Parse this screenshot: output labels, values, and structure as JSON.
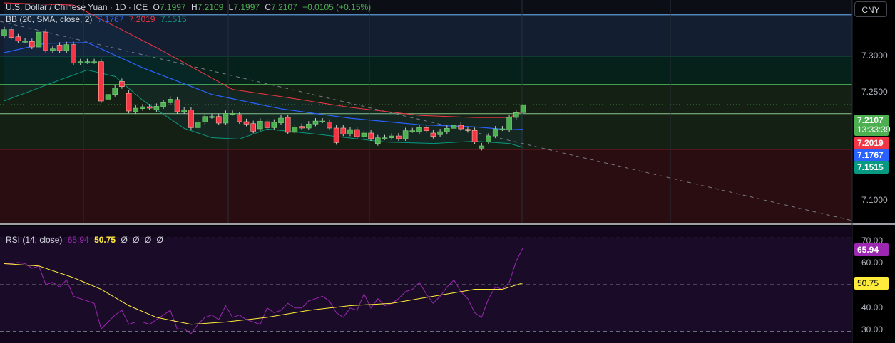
{
  "header": {
    "symbol": "U.S. Dollar / Chinese Yuan · 1D · ICE",
    "open_label": "O",
    "open": "7.1997",
    "high_label": "H",
    "high": "7.2109",
    "low_label": "L",
    "low": "7.1997",
    "close_label": "C",
    "close": "7.2107",
    "change": "+0.0105 (+0.15%)"
  },
  "bb": {
    "label": "BB (20, SMA, close, 2)",
    "basis": "7.1767",
    "upper": "7.2019",
    "lower": "7.1515"
  },
  "rsi": {
    "label": "RSI (14, close)",
    "value": "65.94",
    "ma": "50.75",
    "extra": [
      "Ø",
      "Ø",
      "Ø",
      "Ø"
    ]
  },
  "currency_button": "CNY",
  "price_axis": [
    "7.3000",
    "7.2500",
    "7.1000"
  ],
  "price_tags": {
    "last": "7.2107",
    "countdown": "13:33:39",
    "upper": "7.2019",
    "basis": "7.1767",
    "lower": "7.1515"
  },
  "rsi_axis": [
    "70.00",
    "60.00",
    "40.00",
    "30.00"
  ],
  "rsi_tags": {
    "rsi": "65.94",
    "ma": "50.75"
  },
  "colors": {
    "up": "#4caf50",
    "down": "#f23645",
    "basis": "#2962ff",
    "upper": "#f23645",
    "lower": "#089981",
    "rsi": "#9c27b0",
    "rsi_ma": "#ffeb3b"
  },
  "chart_data": {
    "type": "candlestick",
    "price_range": [
      7.047,
      7.356
    ],
    "zones": [
      {
        "from": 7.3355,
        "to": 7.2783,
        "fill": "#131e30",
        "line": "#5b9bd5"
      },
      {
        "from": 7.2783,
        "to": 7.2388,
        "fill": "#06201a",
        "line": "#2e8b7a"
      },
      {
        "from": 7.2388,
        "to": 7.149,
        "fill": "#142014",
        "line": "#4caf50"
      },
      {
        "from": 7.149,
        "to": 7.047,
        "fill": "#2a0d10",
        "line": "#c2353f"
      }
    ],
    "extra_level": 7.1983,
    "candles": [
      [
        7.3066,
        7.3148
      ],
      [
        7.3148,
        7.304
      ],
      [
        7.3049,
        7.299
      ],
      [
        7.299,
        7.299
      ],
      [
        7.2984,
        7.2908
      ],
      [
        7.2908,
        7.3115
      ],
      [
        7.3115,
        7.2859
      ],
      [
        7.2859,
        7.2882
      ],
      [
        7.2934,
        7.2859
      ],
      [
        7.2859,
        7.2941
      ],
      [
        7.2941,
        7.2684
      ],
      [
        7.2684,
        7.2704
      ],
      [
        7.2704,
        7.2704
      ],
      [
        7.2704,
        7.2704
      ],
      [
        7.2704,
        7.2158
      ],
      [
        7.2184,
        7.225
      ],
      [
        7.225,
        7.2339
      ],
      [
        7.2431,
        7.2359
      ],
      [
        7.2266,
        7.202
      ],
      [
        7.201,
        7.2059
      ],
      [
        7.2053,
        7.2079
      ],
      [
        7.2079,
        7.2059
      ],
      [
        7.2036,
        7.2085
      ],
      [
        7.2079,
        7.2135
      ],
      [
        7.2135,
        7.2184
      ],
      [
        7.2178,
        7.201
      ],
      [
        7.201,
        7.2036
      ],
      [
        7.2036,
        7.1789
      ],
      [
        7.1789,
        7.1865
      ],
      [
        7.1865,
        7.1944
      ],
      [
        7.1944,
        7.1944
      ],
      [
        7.1944,
        7.1852
      ],
      [
        7.1852,
        7.1987
      ],
      [
        7.1987,
        7.1987
      ],
      [
        7.197,
        7.1872
      ],
      [
        7.1872,
        7.1839
      ],
      [
        7.1845,
        7.174
      ],
      [
        7.1773,
        7.1878
      ],
      [
        7.1872,
        7.1789
      ],
      [
        7.1789,
        7.1865
      ],
      [
        7.1855,
        7.1921
      ],
      [
        7.1931,
        7.1724
      ],
      [
        7.1724,
        7.1799
      ],
      [
        7.1806,
        7.1783
      ],
      [
        7.1783,
        7.1839
      ],
      [
        7.1839,
        7.1881
      ],
      [
        7.1881,
        7.1881
      ],
      [
        7.1865,
        7.1783
      ],
      [
        7.1783,
        7.1582
      ],
      [
        7.1783,
        7.1701
      ],
      [
        7.1701,
        7.1763
      ],
      [
        7.1763,
        7.1664
      ],
      [
        7.1664,
        7.1714
      ],
      [
        7.1714,
        7.1635
      ],
      [
        7.1569,
        7.1648
      ],
      [
        7.1648,
        7.1648
      ],
      [
        7.1648,
        7.1674
      ],
      [
        7.1674,
        7.1635
      ],
      [
        7.1635,
        7.1747
      ],
      [
        7.1747,
        7.1747
      ],
      [
        7.1733,
        7.1789
      ],
      [
        7.1789,
        7.1747
      ],
      [
        7.1714,
        7.1668
      ],
      [
        7.1691,
        7.1733
      ],
      [
        7.1733,
        7.178
      ],
      [
        7.178,
        7.1822
      ],
      [
        7.1822,
        7.1773
      ],
      [
        7.1766,
        7.175
      ],
      [
        7.175,
        7.1592
      ],
      [
        7.1503,
        7.1536
      ],
      [
        7.1592,
        7.1674
      ],
      [
        7.1674,
        7.1773
      ],
      [
        7.1773,
        7.1773
      ],
      [
        7.1756,
        7.1931
      ],
      [
        7.1931,
        7.1997
      ],
      [
        7.1997,
        7.2107
      ]
    ],
    "bb_upper_keys": [
      [
        0,
        7.352
      ],
      [
        10,
        7.349
      ],
      [
        22,
        7.29
      ],
      [
        33,
        7.232
      ],
      [
        40,
        7.222
      ],
      [
        50,
        7.207
      ],
      [
        60,
        7.196
      ],
      [
        68,
        7.193
      ],
      [
        73,
        7.193
      ],
      [
        75,
        7.2019
      ]
    ],
    "bb_basis_keys": [
      [
        0,
        7.283
      ],
      [
        6,
        7.296
      ],
      [
        12,
        7.297
      ],
      [
        20,
        7.262
      ],
      [
        30,
        7.225
      ],
      [
        40,
        7.205
      ],
      [
        50,
        7.192
      ],
      [
        60,
        7.183
      ],
      [
        68,
        7.18
      ],
      [
        73,
        7.176
      ],
      [
        75,
        7.1767
      ]
    ],
    "bb_lower_keys": [
      [
        0,
        7.216
      ],
      [
        8,
        7.245
      ],
      [
        12,
        7.259
      ],
      [
        16,
        7.25
      ],
      [
        20,
        7.217
      ],
      [
        26,
        7.178
      ],
      [
        30,
        7.165
      ],
      [
        34,
        7.163
      ],
      [
        38,
        7.177
      ],
      [
        45,
        7.17
      ],
      [
        55,
        7.159
      ],
      [
        62,
        7.157
      ],
      [
        68,
        7.16
      ],
      [
        73,
        7.157
      ],
      [
        75,
        7.1515
      ]
    ],
    "rsi_range": [
      25,
      75
    ],
    "rsi_levels": [
      70,
      50,
      30
    ],
    "rsi_values": [
      59,
      59,
      59.5,
      59,
      57,
      58,
      50,
      51,
      49,
      52,
      45,
      44,
      43,
      42,
      31,
      34,
      37,
      39,
      33,
      34,
      34,
      33,
      35,
      37,
      39,
      31,
      31,
      29,
      33,
      36,
      37,
      35,
      41,
      36,
      37,
      35,
      34,
      33,
      40,
      38,
      39,
      42,
      40,
      40,
      43,
      44,
      45,
      43,
      38,
      36,
      40,
      39,
      46,
      40,
      44,
      41,
      42,
      44,
      47,
      48,
      51,
      46,
      42,
      45,
      49,
      52,
      47,
      44,
      38,
      36,
      44,
      49,
      48,
      51,
      60,
      65.94
    ],
    "rsi_ma_keys": [
      [
        0,
        59
      ],
      [
        5,
        58
      ],
      [
        10,
        53
      ],
      [
        14,
        48
      ],
      [
        18,
        41
      ],
      [
        22,
        36
      ],
      [
        27,
        33
      ],
      [
        32,
        34
      ],
      [
        38,
        36
      ],
      [
        44,
        39
      ],
      [
        50,
        41
      ],
      [
        56,
        42
      ],
      [
        60,
        44
      ],
      [
        64,
        46
      ],
      [
        68,
        48
      ],
      [
        72,
        48
      ],
      [
        75,
        50.75
      ]
    ]
  }
}
